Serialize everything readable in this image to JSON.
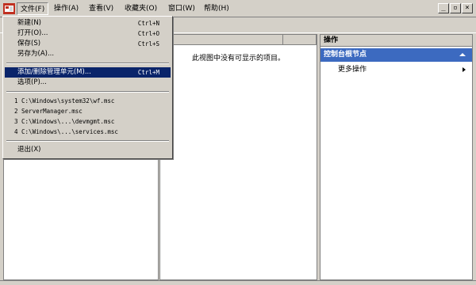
{
  "menubar": {
    "items": [
      {
        "label": "文件(F)"
      },
      {
        "label": "操作(A)"
      },
      {
        "label": "查看(V)"
      },
      {
        "label": "收藏夹(O)"
      },
      {
        "label": "窗口(W)"
      },
      {
        "label": "帮助(H)"
      }
    ],
    "window_buttons": {
      "minimize": "_",
      "restore": "▫",
      "close": "×"
    }
  },
  "file_menu": {
    "group1": [
      {
        "label": "新建(N)",
        "shortcut": "Ctrl+N"
      },
      {
        "label": "打开(O)...",
        "shortcut": "Ctrl+O"
      },
      {
        "label": "保存(S)",
        "shortcut": "Ctrl+S"
      },
      {
        "label": "另存为(A)...",
        "shortcut": ""
      }
    ],
    "group2": [
      {
        "label": "添加/删除管理单元(M)...",
        "shortcut": "Ctrl+M"
      },
      {
        "label": "选项(P)...",
        "shortcut": ""
      }
    ],
    "recent": [
      {
        "label": "1 C:\\Windows\\system32\\wf.msc"
      },
      {
        "label": "2 ServerManager.msc"
      },
      {
        "label": "3 C:\\Windows\\...\\devmgmt.msc"
      },
      {
        "label": "4 C:\\Windows\\...\\services.msc"
      }
    ],
    "exit": {
      "label": "退出(X)"
    }
  },
  "results_pane": {
    "column_fragment": "称",
    "empty_message": "此视图中没有可显示的项目。"
  },
  "actions_pane": {
    "header": "操作",
    "section_title": "控制台根节点",
    "more_actions": "更多操作"
  },
  "colors": {
    "highlight": "#0a246a",
    "section_bar": "#3c6ac0",
    "chrome": "#d4d0c8"
  }
}
